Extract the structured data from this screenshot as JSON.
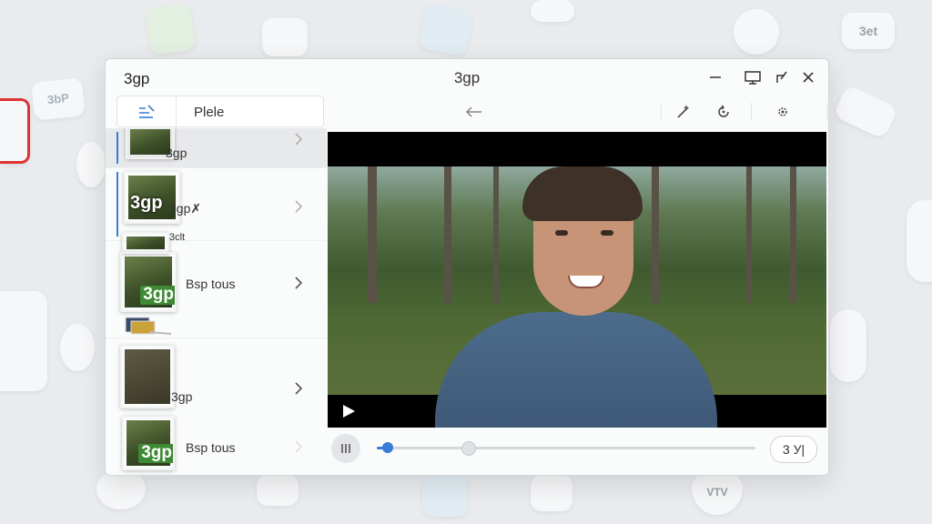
{
  "desktop": {
    "tile_texts": [
      "3et",
      "3bP",
      "VTV"
    ]
  },
  "window": {
    "app_name": "3gp",
    "title": "3gp"
  },
  "toolbar": {
    "tab_label": "Plele"
  },
  "playlist": {
    "items": [
      {
        "label": "3gp",
        "badge": "",
        "selected": true
      },
      {
        "label": "3gp✗",
        "badge": "3gp",
        "selected": false
      },
      {
        "label": "3clt",
        "badge": "",
        "selected": false
      },
      {
        "label": "Bsp tous",
        "badge": "3gp",
        "selected": false
      },
      {
        "label": "3gp",
        "badge": "",
        "selected": false
      },
      {
        "label": "Bsp tous",
        "badge": "3gp",
        "selected": false
      }
    ]
  },
  "player": {
    "progress_fraction": 0.03,
    "buffer_fraction": 0.24,
    "time_label": "3 У|"
  },
  "colors": {
    "accent": "#3a7bd5",
    "badge": "#3f8a35"
  }
}
